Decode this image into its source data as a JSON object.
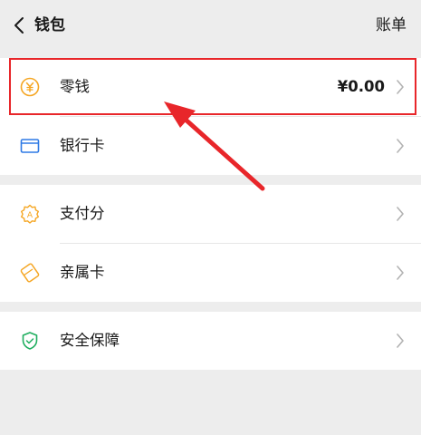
{
  "header": {
    "title": "钱包",
    "bill_label": "账单"
  },
  "groups": [
    {
      "items": [
        {
          "label": "零钱",
          "value": "¥0.00",
          "icon": "yen-coin-icon"
        },
        {
          "label": "银行卡",
          "value": "",
          "icon": "bank-card-icon"
        }
      ]
    },
    {
      "items": [
        {
          "label": "支付分",
          "icon": "pay-score-icon"
        },
        {
          "label": "亲属卡",
          "icon": "family-card-icon"
        }
      ]
    },
    {
      "items": [
        {
          "label": "安全保障",
          "icon": "security-shield-icon"
        }
      ]
    }
  ],
  "colors": {
    "accent_yellow": "#f5a623",
    "accent_blue": "#2f7ae5",
    "accent_green": "#1fae5f",
    "highlight_red": "#e8262a"
  }
}
